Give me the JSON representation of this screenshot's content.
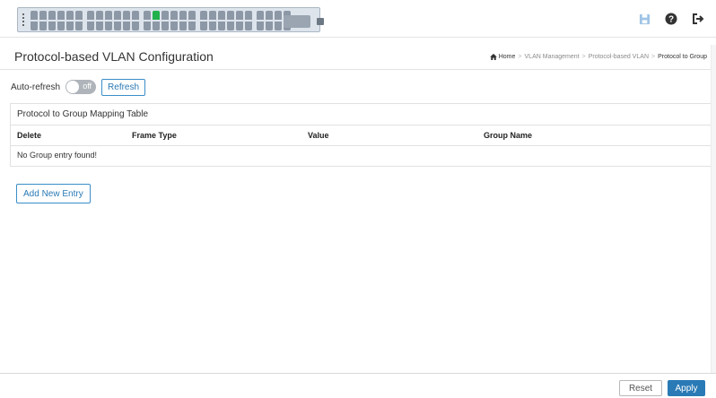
{
  "header": {
    "icons": [
      "save-icon",
      "help-icon",
      "logout-icon"
    ],
    "colors": {
      "save": "#9fc4e6",
      "help": "#333333",
      "logout": "#333333",
      "port_up": "#22b14c",
      "port_down": "#8d98a6"
    }
  },
  "page": {
    "title": "Protocol-based VLAN Configuration"
  },
  "breadcrumb": {
    "home": "Home",
    "items": [
      "VLAN Management",
      "Protocol-based VLAN"
    ],
    "current": "Protocol to Group"
  },
  "refresh": {
    "label": "Auto-refresh",
    "toggle_text": "off",
    "button": "Refresh"
  },
  "table": {
    "title": "Protocol to Group Mapping Table",
    "columns": [
      "Delete",
      "Frame Type",
      "Value",
      "Group Name"
    ],
    "empty_message": "No Group entry found!"
  },
  "actions": {
    "add_new": "Add New Entry",
    "reset": "Reset",
    "apply": "Apply"
  },
  "accent_color": "#2a7ab5"
}
